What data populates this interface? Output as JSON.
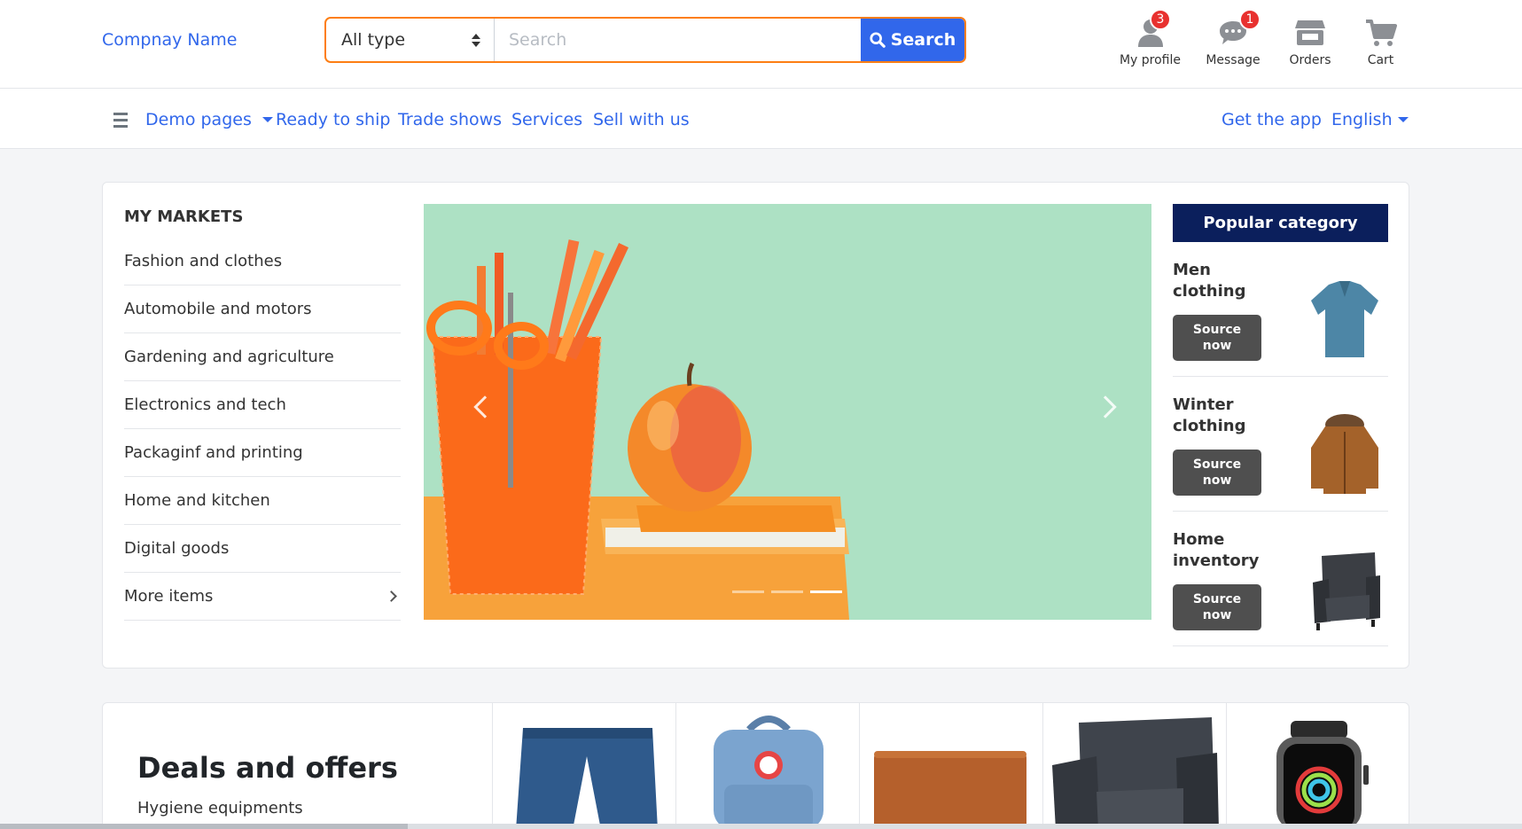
{
  "header": {
    "brand": "Compnay Name",
    "search": {
      "type_value": "All type",
      "placeholder": "Search",
      "button_label": "Search"
    },
    "icons": [
      {
        "label": "My profile",
        "icon": "user-icon",
        "badge": "3"
      },
      {
        "label": "Message",
        "icon": "chat-icon",
        "badge": "1"
      },
      {
        "label": "Orders",
        "icon": "store-icon",
        "badge": ""
      },
      {
        "label": "Cart",
        "icon": "cart-icon",
        "badge": ""
      }
    ]
  },
  "nav": {
    "left": [
      "Demo pages",
      "Ready to ship",
      "Trade shows",
      "Services",
      "Sell with us"
    ],
    "right": [
      "Get the app",
      "English"
    ]
  },
  "markets": {
    "title": "MY MARKETS",
    "items": [
      "Fashion and clothes",
      "Automobile and motors",
      "Gardening and agriculture",
      "Electronics and tech",
      "Packaginf and printing",
      "Home and kitchen",
      "Digital goods",
      "More items"
    ]
  },
  "slider": {
    "slides": 3,
    "active_slide": 3
  },
  "popular": {
    "title": "Popular category",
    "items": [
      {
        "name": "Men clothing",
        "button": "Source now",
        "image": "polo-shirt"
      },
      {
        "name": "Winter clothing",
        "button": "Source now",
        "image": "winter-jacket"
      },
      {
        "name": "Home inventory",
        "button": "Source now",
        "image": "armchair"
      }
    ]
  },
  "deals": {
    "title": "Deals and offers",
    "subtitle": "Hygiene equipments",
    "products": [
      "jeans",
      "backpack",
      "laptop-sleeve",
      "armchair",
      "smartwatch"
    ]
  },
  "colors": {
    "primary": "#3167eb",
    "accent_border": "#fd7e14",
    "badge": "#e8312f",
    "popular_header": "#0b1f5c",
    "source_button": "#4f4f4f"
  }
}
